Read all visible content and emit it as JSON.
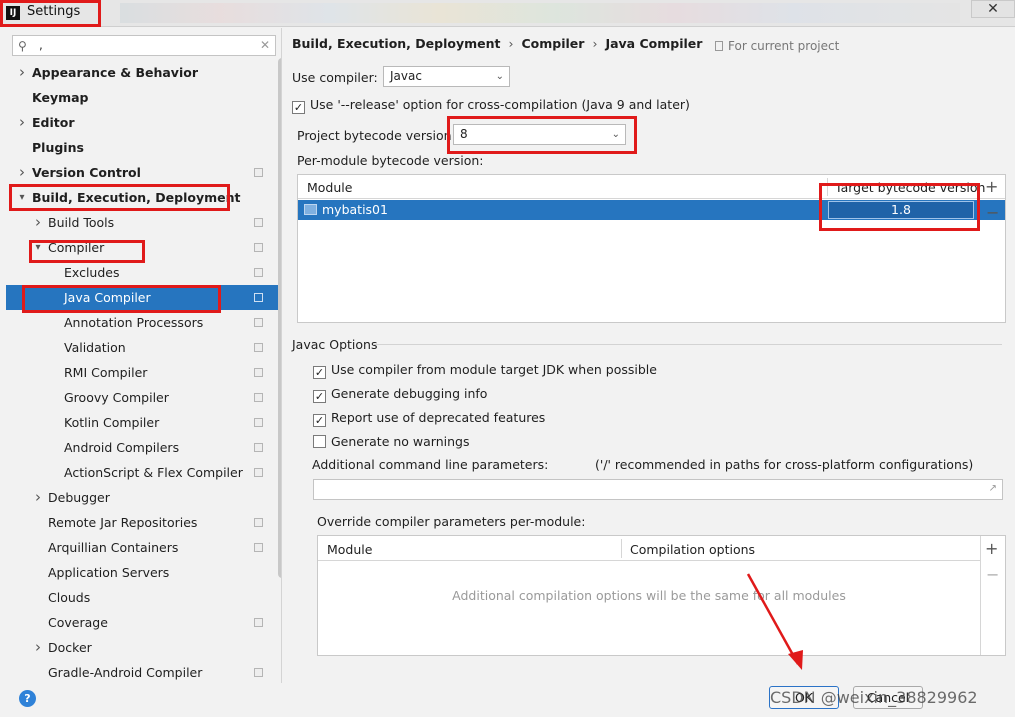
{
  "window": {
    "title": "Settings",
    "app_icon": "IJ"
  },
  "sidebar": {
    "search_value": ",",
    "items": [
      {
        "label": "Appearance & Behavior",
        "expandable": true,
        "expanded": false,
        "bold": true,
        "indent": 0
      },
      {
        "label": "Keymap",
        "bold": true,
        "indent": 0
      },
      {
        "label": "Editor",
        "expandable": true,
        "expanded": false,
        "bold": true,
        "indent": 0
      },
      {
        "label": "Plugins",
        "bold": true,
        "indent": 0
      },
      {
        "label": "Version Control",
        "expandable": true,
        "expanded": false,
        "bold": true,
        "indent": 0,
        "project_icon": true
      },
      {
        "label": "Build, Execution, Deployment",
        "expandable": true,
        "expanded": true,
        "bold": true,
        "indent": 0
      },
      {
        "label": "Build Tools",
        "expandable": true,
        "expanded": false,
        "indent": 1,
        "project_icon": true
      },
      {
        "label": "Compiler",
        "expandable": true,
        "expanded": true,
        "indent": 1,
        "project_icon": true
      },
      {
        "label": "Excludes",
        "indent": 2,
        "project_icon": true
      },
      {
        "label": "Java Compiler",
        "indent": 2,
        "project_icon": true,
        "selected": true
      },
      {
        "label": "Annotation Processors",
        "indent": 2,
        "project_icon": true
      },
      {
        "label": "Validation",
        "indent": 2,
        "project_icon": true
      },
      {
        "label": "RMI Compiler",
        "indent": 2,
        "project_icon": true
      },
      {
        "label": "Groovy Compiler",
        "indent": 2,
        "project_icon": true
      },
      {
        "label": "Kotlin Compiler",
        "indent": 2,
        "project_icon": true
      },
      {
        "label": "Android Compilers",
        "indent": 2,
        "project_icon": true
      },
      {
        "label": "ActionScript & Flex Compiler",
        "indent": 2,
        "project_icon": true
      },
      {
        "label": "Debugger",
        "expandable": true,
        "expanded": false,
        "indent": 1
      },
      {
        "label": "Remote Jar Repositories",
        "indent": 1,
        "project_icon": true
      },
      {
        "label": "Arquillian Containers",
        "indent": 1,
        "project_icon": true
      },
      {
        "label": "Application Servers",
        "indent": 1
      },
      {
        "label": "Clouds",
        "indent": 1
      },
      {
        "label": "Coverage",
        "indent": 1,
        "project_icon": true
      },
      {
        "label": "Docker",
        "expandable": true,
        "expanded": false,
        "indent": 1
      },
      {
        "label": "Gradle-Android Compiler",
        "indent": 1,
        "project_icon": true
      }
    ]
  },
  "main": {
    "breadcrumb": [
      "Build, Execution, Deployment",
      "Compiler",
      "Java Compiler"
    ],
    "for_current_project": "For current project",
    "use_compiler_label": "Use compiler:",
    "use_compiler_value": "Javac",
    "release_option": {
      "label": "Use '--release' option for cross-compilation (Java 9 and later)",
      "checked": true
    },
    "bytecode_label": "Project bytecode version:",
    "bytecode_value": "8",
    "per_module_label": "Per-module bytecode version:",
    "module_table": {
      "columns": [
        "Module",
        "Target bytecode version"
      ],
      "rows": [
        {
          "module": "mybatis01",
          "version": "1.8"
        }
      ]
    },
    "javac_options": {
      "title": "Javac Options",
      "checkboxes": [
        {
          "label": "Use compiler from module target JDK when possible",
          "checked": true
        },
        {
          "label": "Generate debugging info",
          "checked": true
        },
        {
          "label": "Report use of deprecated features",
          "checked": true
        },
        {
          "label": "Generate no warnings",
          "checked": false
        }
      ],
      "params_label": "Additional command line parameters:",
      "params_hint": "('/' recommended in paths for cross-platform configurations)",
      "params_value": ""
    },
    "override": {
      "label": "Override compiler parameters per-module:",
      "columns": [
        "Module",
        "Compilation options"
      ],
      "empty_text": "Additional compilation options will be the same for all modules"
    }
  },
  "buttons": {
    "ok": "OK",
    "cancel": "Cancel"
  },
  "watermark": "CSDN @weixin_38829962",
  "colors": {
    "selection": "#2675bf",
    "highlight": "#e01a1a"
  }
}
